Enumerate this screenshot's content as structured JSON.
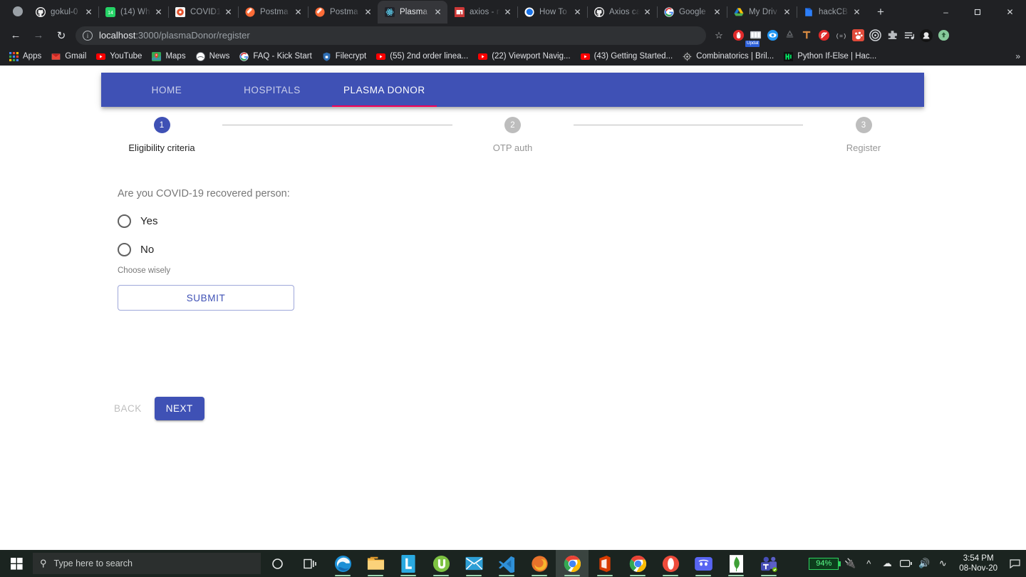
{
  "browser": {
    "tabs": [
      {
        "title": "gokul-0",
        "icon": "github-icon",
        "icon_type": "github",
        "active": false
      },
      {
        "title": "(14) Wh",
        "icon": "whatsapp-icon",
        "icon_type": "whatsapp",
        "active": false
      },
      {
        "title": "COVID1",
        "icon": "covid-icon",
        "icon_type": "orange-square",
        "active": false
      },
      {
        "title": "Postma",
        "icon": "postman-icon",
        "icon_type": "postman",
        "active": false
      },
      {
        "title": "Postma",
        "icon": "postman-icon",
        "icon_type": "postman",
        "active": false
      },
      {
        "title": "Plasma",
        "icon": "react-icon",
        "icon_type": "react",
        "active": true
      },
      {
        "title": "axios - n",
        "icon": "npm-icon",
        "icon_type": "npm",
        "active": false
      },
      {
        "title": "How To",
        "icon": "howto-icon",
        "icon_type": "blue-circle",
        "active": false
      },
      {
        "title": "Axios ca",
        "icon": "github-icon",
        "icon_type": "github",
        "active": false
      },
      {
        "title": "Google",
        "icon": "google-icon",
        "icon_type": "google",
        "active": false
      },
      {
        "title": "My Driv",
        "icon": "google-drive-icon",
        "icon_type": "drive",
        "active": false
      },
      {
        "title": "hackCB",
        "icon": "hackcb-icon",
        "icon_type": "blue-doc",
        "active": false
      }
    ],
    "new_tab_label": "+",
    "window_controls": {
      "minimize": "–",
      "maximize": "❐",
      "close": "✕"
    },
    "nav": {
      "back": "←",
      "forward": "→",
      "reload": "↻"
    },
    "omnibox": {
      "site_info_icon": "info-icon",
      "url_host": "localhost",
      "url_path": ":3000/plasmaDonor/register",
      "bookmark_star": "☆"
    },
    "extensions": [
      {
        "name": "adblock-icon"
      },
      {
        "name": "update-extension-icon",
        "badge": "Updat"
      },
      {
        "name": "eye-icon"
      },
      {
        "name": "recycle-icon"
      },
      {
        "name": "tampermonkey-icon"
      },
      {
        "name": "stop-icon"
      },
      {
        "name": "brackets-icon"
      },
      {
        "name": "red-paw-icon"
      },
      {
        "name": "target-icon"
      },
      {
        "name": "puzzle-icon"
      },
      {
        "name": "playlist-icon"
      },
      {
        "name": "avatar-icon"
      },
      {
        "name": "upload-icon"
      }
    ],
    "bookmarks": [
      {
        "label": "Apps",
        "icon": "apps-grid-icon"
      },
      {
        "label": "Gmail",
        "icon": "gmail-icon"
      },
      {
        "label": "YouTube",
        "icon": "youtube-icon"
      },
      {
        "label": "Maps",
        "icon": "maps-icon"
      },
      {
        "label": "News",
        "icon": "news-icon"
      },
      {
        "label": "FAQ - Kick Start",
        "icon": "google-icon"
      },
      {
        "label": "Filecrypt",
        "icon": "filecrypt-icon"
      },
      {
        "label": "(55) 2nd order linea...",
        "icon": "youtube-icon"
      },
      {
        "label": "(22) Viewport Navig...",
        "icon": "youtube-icon"
      },
      {
        "label": "(43) Getting Started...",
        "icon": "youtube-icon"
      },
      {
        "label": "Combinatorics | Bril...",
        "icon": "brilliant-icon"
      },
      {
        "label": "Python If-Else | Hac...",
        "icon": "hackerrank-icon"
      }
    ],
    "bookmarks_overflow": "»"
  },
  "page": {
    "navtabs": [
      {
        "label": "HOME",
        "active": false
      },
      {
        "label": "HOSPITALS",
        "active": false
      },
      {
        "label": "PLASMA DONOR",
        "active": true
      }
    ],
    "stepper": [
      {
        "number": "1",
        "label": "Eligibility criteria",
        "active": true
      },
      {
        "number": "2",
        "label": "OTP auth",
        "active": false
      },
      {
        "number": "3",
        "label": "Register",
        "active": false
      }
    ],
    "form": {
      "question": "Are you COVID-19 recovered person:",
      "option_yes": "Yes",
      "option_no": "No",
      "helper_text": "Choose wisely",
      "submit_label": "SUBMIT"
    },
    "actions": {
      "back_label": "BACK",
      "next_label": "NEXT"
    },
    "colors": {
      "primary": "#3f51b5",
      "accent": "#f50057",
      "inactive_step": "#bdbdbd"
    }
  },
  "taskbar": {
    "start_icon": "windows-start-icon",
    "search_placeholder": "Type here to search",
    "cortana_icon": "cortana-icon",
    "taskview_icon": "task-view-icon",
    "apps": [
      {
        "name": "edge-icon"
      },
      {
        "name": "file-explorer-icon"
      },
      {
        "name": "l-app-icon"
      },
      {
        "name": "utorrent-icon"
      },
      {
        "name": "mail-icon"
      },
      {
        "name": "vscode-icon"
      },
      {
        "name": "firefox-icon"
      },
      {
        "name": "chrome-icon"
      },
      {
        "name": "office-icon"
      },
      {
        "name": "chrome-icon"
      },
      {
        "name": "opera-icon"
      },
      {
        "name": "discord-icon"
      },
      {
        "name": "mongodb-icon"
      },
      {
        "name": "teams-icon"
      }
    ],
    "tray": {
      "battery_percent": "94%",
      "plug_icon": "plug-icon",
      "chevron_icon": "chevron-up-icon",
      "headphone_icon": "headphone-icon",
      "battery_icon": "battery-icon",
      "volume_icon": "volume-icon",
      "wifi_icon": "wifi-icon",
      "time": "3:54 PM",
      "date": "08-Nov-20",
      "action_center_icon": "action-center-icon"
    }
  }
}
